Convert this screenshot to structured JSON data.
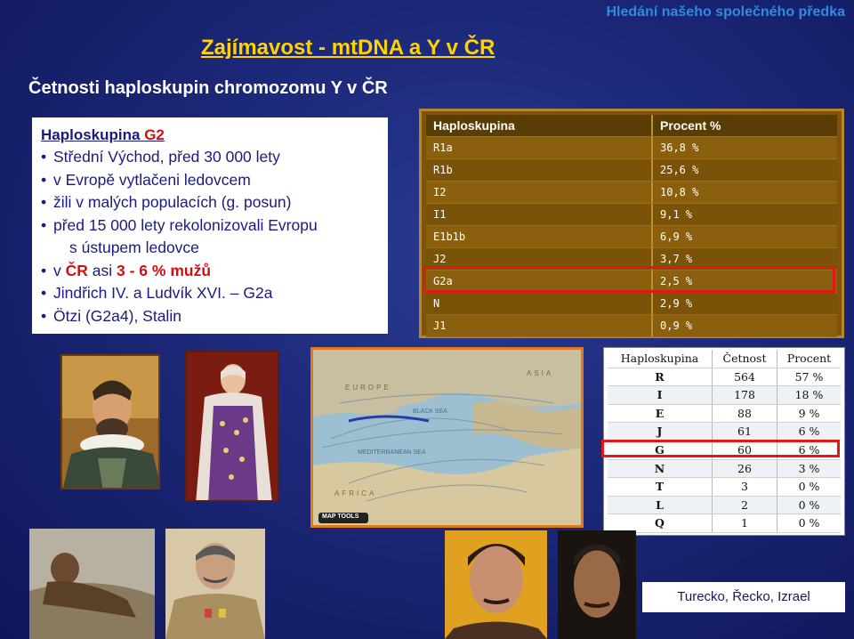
{
  "top_tag": "Hledání našeho společného předka",
  "main_title": "Zajímavost - mtDNA a Y v ČR",
  "subtitle": "Četnosti haploskupin chromozomu Y v ČR",
  "textbox": {
    "head_prefix": "Haploskupina ",
    "head_name": "G2",
    "lines": [
      "Střední Východ, před 30 000 lety",
      "v Evropě vytlačeni ledovcem",
      "žili v malých populacích (g. posun)",
      "před 15 000 lety rekolonizovali Evropu",
      "s ústupem ledovce",
      "Jindřich IV. a  Ludvík XVI. – G2a",
      "Ötzi (G2a4), Stalin"
    ],
    "cz_prefix": "v ",
    "cz_country": "ČR",
    "cz_mid": " asi ",
    "cz_value": "3 - 6 % mužů"
  },
  "table_left": {
    "headers": [
      "Haploskupina",
      "Procent %"
    ],
    "rows": [
      [
        "R1a",
        "36,8 %"
      ],
      [
        "R1b",
        "25,6 %"
      ],
      [
        "I2",
        "10,8 %"
      ],
      [
        "I1",
        "9,1 %"
      ],
      [
        "E1b1b",
        "6,9 %"
      ],
      [
        "J2",
        "3,7 %"
      ],
      [
        "G2a",
        "2,5 %"
      ],
      [
        "N",
        "2,9 %"
      ],
      [
        "J1",
        "0,9 %"
      ]
    ],
    "highlight": "G2a"
  },
  "table_right": {
    "headers": [
      "Haploskupina",
      "Četnost",
      "Procent"
    ],
    "rows": [
      [
        "R",
        "564",
        "57 %"
      ],
      [
        "I",
        "178",
        "18 %"
      ],
      [
        "E",
        "88",
        "9 %"
      ],
      [
        "J",
        "61",
        "6 %"
      ],
      [
        "G",
        "60",
        "6 %"
      ],
      [
        "N",
        "26",
        "3 %"
      ],
      [
        "T",
        "3",
        "0 %"
      ],
      [
        "L",
        "2",
        "0 %"
      ],
      [
        "Q",
        "1",
        "0 %"
      ]
    ],
    "highlight": "G"
  },
  "map": {
    "labels": [
      "EUROPE",
      "ASIA",
      "BLACK SEA",
      "MEDITERRANEAN SEA",
      "AFRICA"
    ],
    "button": "MAP TOOLS"
  },
  "caption": "Turecko, Řecko, Izrael",
  "colors": {
    "background": "#1c2878",
    "title": "#ffd200",
    "accent_red": "#d01010",
    "highlight_border": "#e01818",
    "table_left_bg": "#7c5508"
  }
}
